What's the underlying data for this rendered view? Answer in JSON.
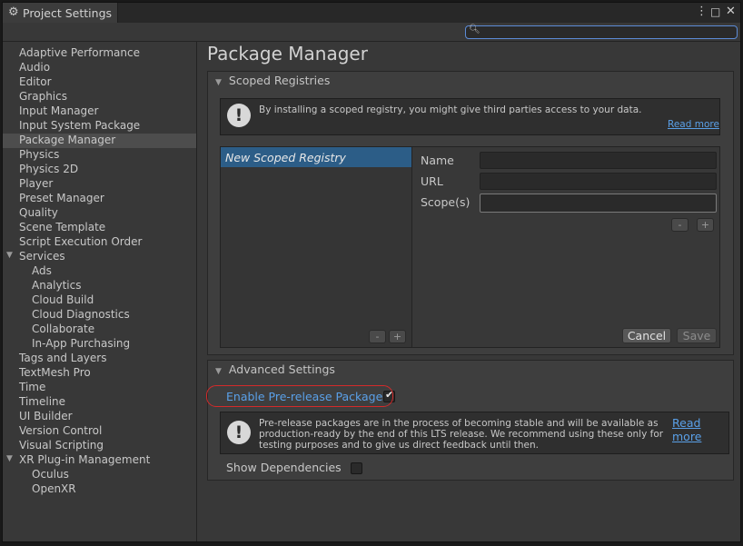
{
  "window": {
    "title": "Project Settings",
    "controls": {
      "more": "⋮",
      "maximize": "□",
      "close": "✕"
    }
  },
  "search": {
    "placeholder": ""
  },
  "sidebar": {
    "items": [
      {
        "label": "Adaptive Performance",
        "level": 0
      },
      {
        "label": "Audio",
        "level": 0
      },
      {
        "label": "Editor",
        "level": 0
      },
      {
        "label": "Graphics",
        "level": 0
      },
      {
        "label": "Input Manager",
        "level": 0
      },
      {
        "label": "Input System Package",
        "level": 0
      },
      {
        "label": "Package Manager",
        "level": 0,
        "selected": true
      },
      {
        "label": "Physics",
        "level": 0
      },
      {
        "label": "Physics 2D",
        "level": 0
      },
      {
        "label": "Player",
        "level": 0
      },
      {
        "label": "Preset Manager",
        "level": 0
      },
      {
        "label": "Quality",
        "level": 0
      },
      {
        "label": "Scene Template",
        "level": 0
      },
      {
        "label": "Script Execution Order",
        "level": 0
      },
      {
        "label": "Services",
        "level": 0,
        "expanded": true
      },
      {
        "label": "Ads",
        "level": 1
      },
      {
        "label": "Analytics",
        "level": 1
      },
      {
        "label": "Cloud Build",
        "level": 1
      },
      {
        "label": "Cloud Diagnostics",
        "level": 1
      },
      {
        "label": "Collaborate",
        "level": 1
      },
      {
        "label": "In-App Purchasing",
        "level": 1
      },
      {
        "label": "Tags and Layers",
        "level": 0
      },
      {
        "label": "TextMesh Pro",
        "level": 0
      },
      {
        "label": "Time",
        "level": 0
      },
      {
        "label": "Timeline",
        "level": 0
      },
      {
        "label": "UI Builder",
        "level": 0
      },
      {
        "label": "Version Control",
        "level": 0
      },
      {
        "label": "Visual Scripting",
        "level": 0
      },
      {
        "label": "XR Plug-in Management",
        "level": 0,
        "expanded": true
      },
      {
        "label": "Oculus",
        "level": 1
      },
      {
        "label": "OpenXR",
        "level": 1
      }
    ]
  },
  "main": {
    "title": "Package Manager",
    "scoped": {
      "header": "Scoped Registries",
      "help_text": "By installing a scoped registry, you might give third parties access to your data.",
      "read_more": "Read more",
      "registries": [
        "New Scoped Registry"
      ],
      "list_minus": "-",
      "list_plus": "+",
      "fields": {
        "name": "Name",
        "url": "URL",
        "scopes": "Scope(s)"
      },
      "scope_minus": "-",
      "scope_plus": "+",
      "cancel": "Cancel",
      "save": "Save"
    },
    "advanced": {
      "header": "Advanced Settings",
      "prerelease_label": "Enable Pre-release Packages",
      "prerelease_checked": true,
      "help_lines": [
        "Pre-release packages are in the process of becoming stable and will be available as",
        "production-ready by the end of this LTS release. We recommend using these only for",
        "testing purposes and to give us direct feedback until then."
      ],
      "read_more": "Read more",
      "show_deps_label": "Show Dependencies",
      "show_deps_checked": false
    }
  },
  "colors": {
    "selection": "#4d4d4d",
    "registry_selection": "#2c5d87",
    "link": "#5aa0e8",
    "highlight_oval": "#d42a2a"
  }
}
